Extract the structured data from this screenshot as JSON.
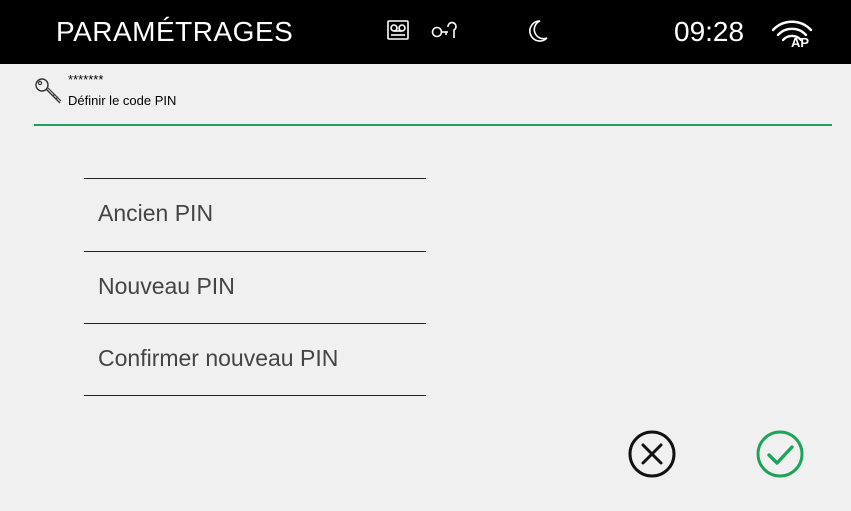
{
  "topbar": {
    "title": "PARAMÉTRAGES",
    "time": "09:28",
    "icons": [
      "voicemail-icon",
      "door-key-icon",
      "moon-icon",
      "wifi-ap-icon"
    ],
    "wifi_label": "AP"
  },
  "header": {
    "masked_value": "*******",
    "subtitle": "Définir le code PIN",
    "icon": "key-icon",
    "accent_color": "#1fa35a"
  },
  "fields": {
    "old_pin": "Ancien PIN",
    "new_pin": "Nouveau PIN",
    "confirm_pin": "Confirmer nouveau PIN"
  },
  "actions": {
    "cancel": "cancel-icon",
    "confirm": "confirm-icon",
    "confirm_color": "#1fa35a"
  }
}
